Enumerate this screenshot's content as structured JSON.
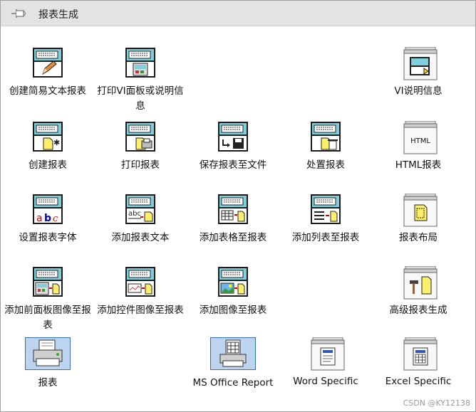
{
  "palette": {
    "title": "报表生成",
    "pin_icon": "pin-icon"
  },
  "items": [
    {
      "label": "创建简易文本报表",
      "icon": "easy-text-report-icon"
    },
    {
      "label": "打印VI面板或说明信息",
      "icon": "print-vi-panel-icon"
    },
    {
      "label": "VI说明信息",
      "icon": "vi-documentation-icon"
    },
    {
      "label": "创建报表",
      "icon": "new-report-icon"
    },
    {
      "label": "打印报表",
      "icon": "print-report-icon"
    },
    {
      "label": "保存报表至文件",
      "icon": "save-report-to-file-icon"
    },
    {
      "label": "处置报表",
      "icon": "dispose-report-icon"
    },
    {
      "label": "HTML报表",
      "icon": "html-report-icon",
      "glyph": "HTML"
    },
    {
      "label": "设置报表字体",
      "icon": "set-report-font-icon",
      "glyph": "abc"
    },
    {
      "label": "添加报表文本",
      "icon": "append-report-text-icon",
      "glyph": "abc"
    },
    {
      "label": "添加表格至报表",
      "icon": "append-table-to-report-icon"
    },
    {
      "label": "添加列表至报表",
      "icon": "append-list-to-report-icon"
    },
    {
      "label": "报表布局",
      "icon": "report-layout-icon"
    },
    {
      "label": "添加前面板图像至报表",
      "icon": "append-front-panel-image-icon"
    },
    {
      "label": "添加控件图像至报表",
      "icon": "append-control-image-icon"
    },
    {
      "label": "添加图像至报表",
      "icon": "append-image-to-report-icon"
    },
    {
      "label": "高级报表生成",
      "icon": "advanced-report-generation-icon"
    },
    {
      "label": "报表",
      "icon": "report-express-vi-icon"
    },
    {
      "label": "MS Office Report",
      "icon": "ms-office-report-icon"
    },
    {
      "label": "Word Specific",
      "icon": "word-specific-icon"
    },
    {
      "label": "Excel Specific",
      "icon": "excel-specific-icon"
    }
  ],
  "watermark": "CSDN @KY12138"
}
